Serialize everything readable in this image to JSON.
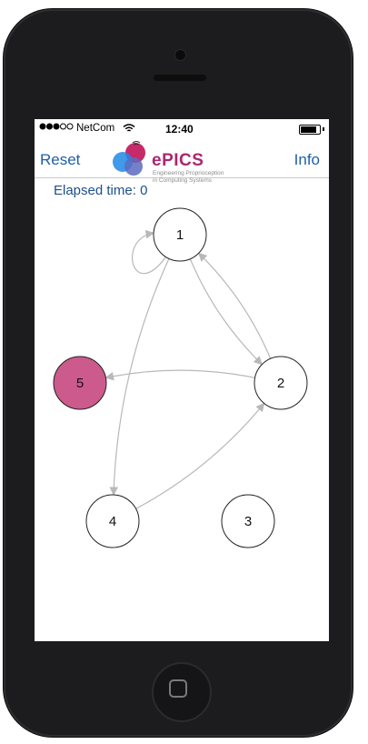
{
  "status_bar": {
    "carrier": "NetCom",
    "time": "12:40",
    "signal_bars_filled": 3,
    "signal_bars_total": 5,
    "battery_level": 0.85
  },
  "nav": {
    "reset_label": "Reset",
    "info_label": "Info",
    "logo": {
      "name": "ePICS",
      "tagline_line1": "Engineering Proprioception",
      "tagline_line2": "in Computing Systems",
      "colors": [
        "#c2185b",
        "#1e88e5",
        "#5c6bc0"
      ]
    }
  },
  "elapsed": {
    "label": "Elapsed time:",
    "value": "0"
  },
  "graph": {
    "nodes": [
      {
        "id": "1",
        "label": "1",
        "active": false
      },
      {
        "id": "2",
        "label": "2",
        "active": false
      },
      {
        "id": "3",
        "label": "3",
        "active": false
      },
      {
        "id": "4",
        "label": "4",
        "active": false
      },
      {
        "id": "5",
        "label": "5",
        "active": true
      }
    ],
    "edges": [
      {
        "from": "1",
        "to": "1"
      },
      {
        "from": "1",
        "to": "2"
      },
      {
        "from": "2",
        "to": "1"
      },
      {
        "from": "2",
        "to": "5"
      },
      {
        "from": "1",
        "to": "4"
      },
      {
        "from": "4",
        "to": "2"
      }
    ],
    "colors": {
      "node_fill": "#ffffff",
      "active_fill": "#cc5a8c",
      "node_stroke": "#222222",
      "edge": "#b8b8b8"
    }
  }
}
